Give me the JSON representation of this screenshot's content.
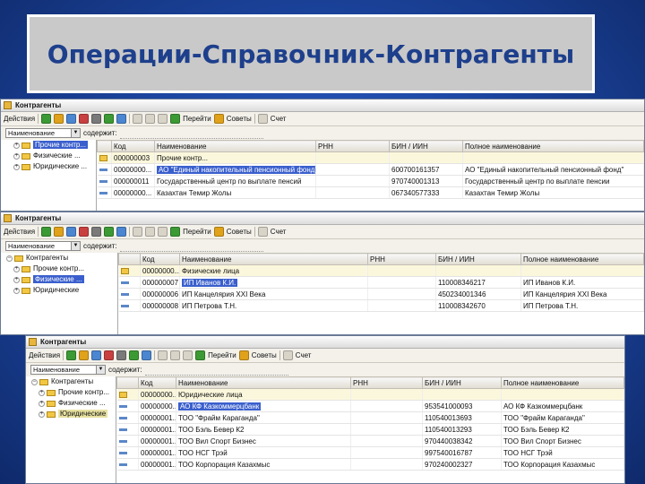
{
  "slide": {
    "title": "Операции-Справочник-Контрагенты"
  },
  "toolbar": {
    "actions": "Действия",
    "go": "Перейти",
    "tips": "Советы",
    "account": "Счет"
  },
  "filter": {
    "field": "Наименование",
    "label": "содержит:"
  },
  "windows": [
    {
      "title": "Контрагенты",
      "tree": [
        {
          "label": "Прочие контр...",
          "state": "sel"
        },
        {
          "label": "Физические ...",
          "state": ""
        },
        {
          "label": "Юридические ...",
          "state": ""
        }
      ],
      "columns": [
        "",
        "Код",
        "Наименование",
        "РНН",
        "БИН / ИИН",
        "Полное наименование"
      ],
      "rows": [
        {
          "icon": "folder",
          "code": "000000003",
          "name": "Прочие контр...",
          "rnn": "",
          "bin": "",
          "full": ""
        },
        {
          "icon": "item",
          "code": "00000000...",
          "name": "АО \"Единый накопительный пенсионный фонд\"",
          "rnn": "",
          "bin": "600700161357",
          "full": "АО \"Единый накопительный пенсионный фонд\"",
          "hl": true
        },
        {
          "icon": "item",
          "code": "000000011",
          "name": "Государственный центр по выплате пенсий",
          "rnn": "",
          "bin": "970740001313",
          "full": "Государственный центр по выплате пенсии"
        },
        {
          "icon": "item",
          "code": "00000000...",
          "name": "Казахтан Темир Жолы",
          "rnn": "",
          "bin": "067340577333",
          "full": "Казахтан Темир Жолы"
        }
      ]
    },
    {
      "title": "Контрагенты",
      "tree": [
        {
          "label": "Контрагенты",
          "state": ""
        },
        {
          "label": "Прочие контр...",
          "state": ""
        },
        {
          "label": "Физические ...",
          "state": "sel"
        },
        {
          "label": "Юридические",
          "state": ""
        }
      ],
      "columns": [
        "",
        "Код",
        "Наименование",
        "РНН",
        "БИН / ИИН",
        "Полное наименование"
      ],
      "rows": [
        {
          "icon": "folder",
          "code": "00000000...",
          "name": "Физические лица",
          "rnn": "",
          "bin": "",
          "full": ""
        },
        {
          "icon": "item",
          "code": "000000007",
          "name": "ИП Иванов К.И.",
          "rnn": "",
          "bin": "110008346217",
          "full": "ИП Иванов К.И.",
          "hl": true
        },
        {
          "icon": "item",
          "code": "000000006",
          "name": "ИП Канцелярия XXI Века",
          "rnn": "",
          "bin": "450234001346",
          "full": "ИП Канцелярия XXI Века"
        },
        {
          "icon": "item",
          "code": "000000008",
          "name": "ИП Петрова Т.Н.",
          "rnn": "",
          "bin": "110008342670",
          "full": "ИП Петрова Т.Н."
        }
      ]
    },
    {
      "title": "Контрагенты",
      "tree": [
        {
          "label": "Контрагенты",
          "state": ""
        },
        {
          "label": "Прочие контр...",
          "state": ""
        },
        {
          "label": "Физические ...",
          "state": ""
        },
        {
          "label": "Юридические",
          "state": "sel2"
        }
      ],
      "columns": [
        "",
        "Код",
        "Наименование",
        "РНН",
        "БИН / ИИН",
        "Полное наименование"
      ],
      "rows": [
        {
          "icon": "folder",
          "code": "00000000...",
          "name": "Юридические лица",
          "rnn": "",
          "bin": "",
          "full": ""
        },
        {
          "icon": "item",
          "code": "00000000...",
          "name": "АО КФ Казкоммерцбанк",
          "rnn": "",
          "bin": "953541000093",
          "full": "АО КФ Казкоммерцбанк",
          "hl": true
        },
        {
          "icon": "item",
          "code": "00000001...",
          "name": "ТОО \"Фрайм Карагандa\"",
          "rnn": "",
          "bin": "110540013693",
          "full": "ТОО \"Фрайм Карагандa\""
        },
        {
          "icon": "item",
          "code": "00000001...",
          "name": "ТОО Бэль Бевер К2",
          "rnn": "",
          "bin": "110540013293",
          "full": "ТОО Бэль Бевер К2"
        },
        {
          "icon": "item",
          "code": "00000001...",
          "name": "ТОО Вил Спорт Бизнес",
          "rnn": "",
          "bin": "970440038342",
          "full": "ТОО Вил Спорт Бизнес"
        },
        {
          "icon": "item",
          "code": "00000001...",
          "name": "ТОО НСГ Трэй",
          "rnn": "",
          "bin": "997540016787",
          "full": "ТОО НСГ Трэй"
        },
        {
          "icon": "item",
          "code": "00000001...",
          "name": "ТОО Корпорация Казахмыс",
          "rnn": "",
          "bin": "970240002327",
          "full": "ТОО Корпорация Казахмыс"
        }
      ]
    }
  ]
}
